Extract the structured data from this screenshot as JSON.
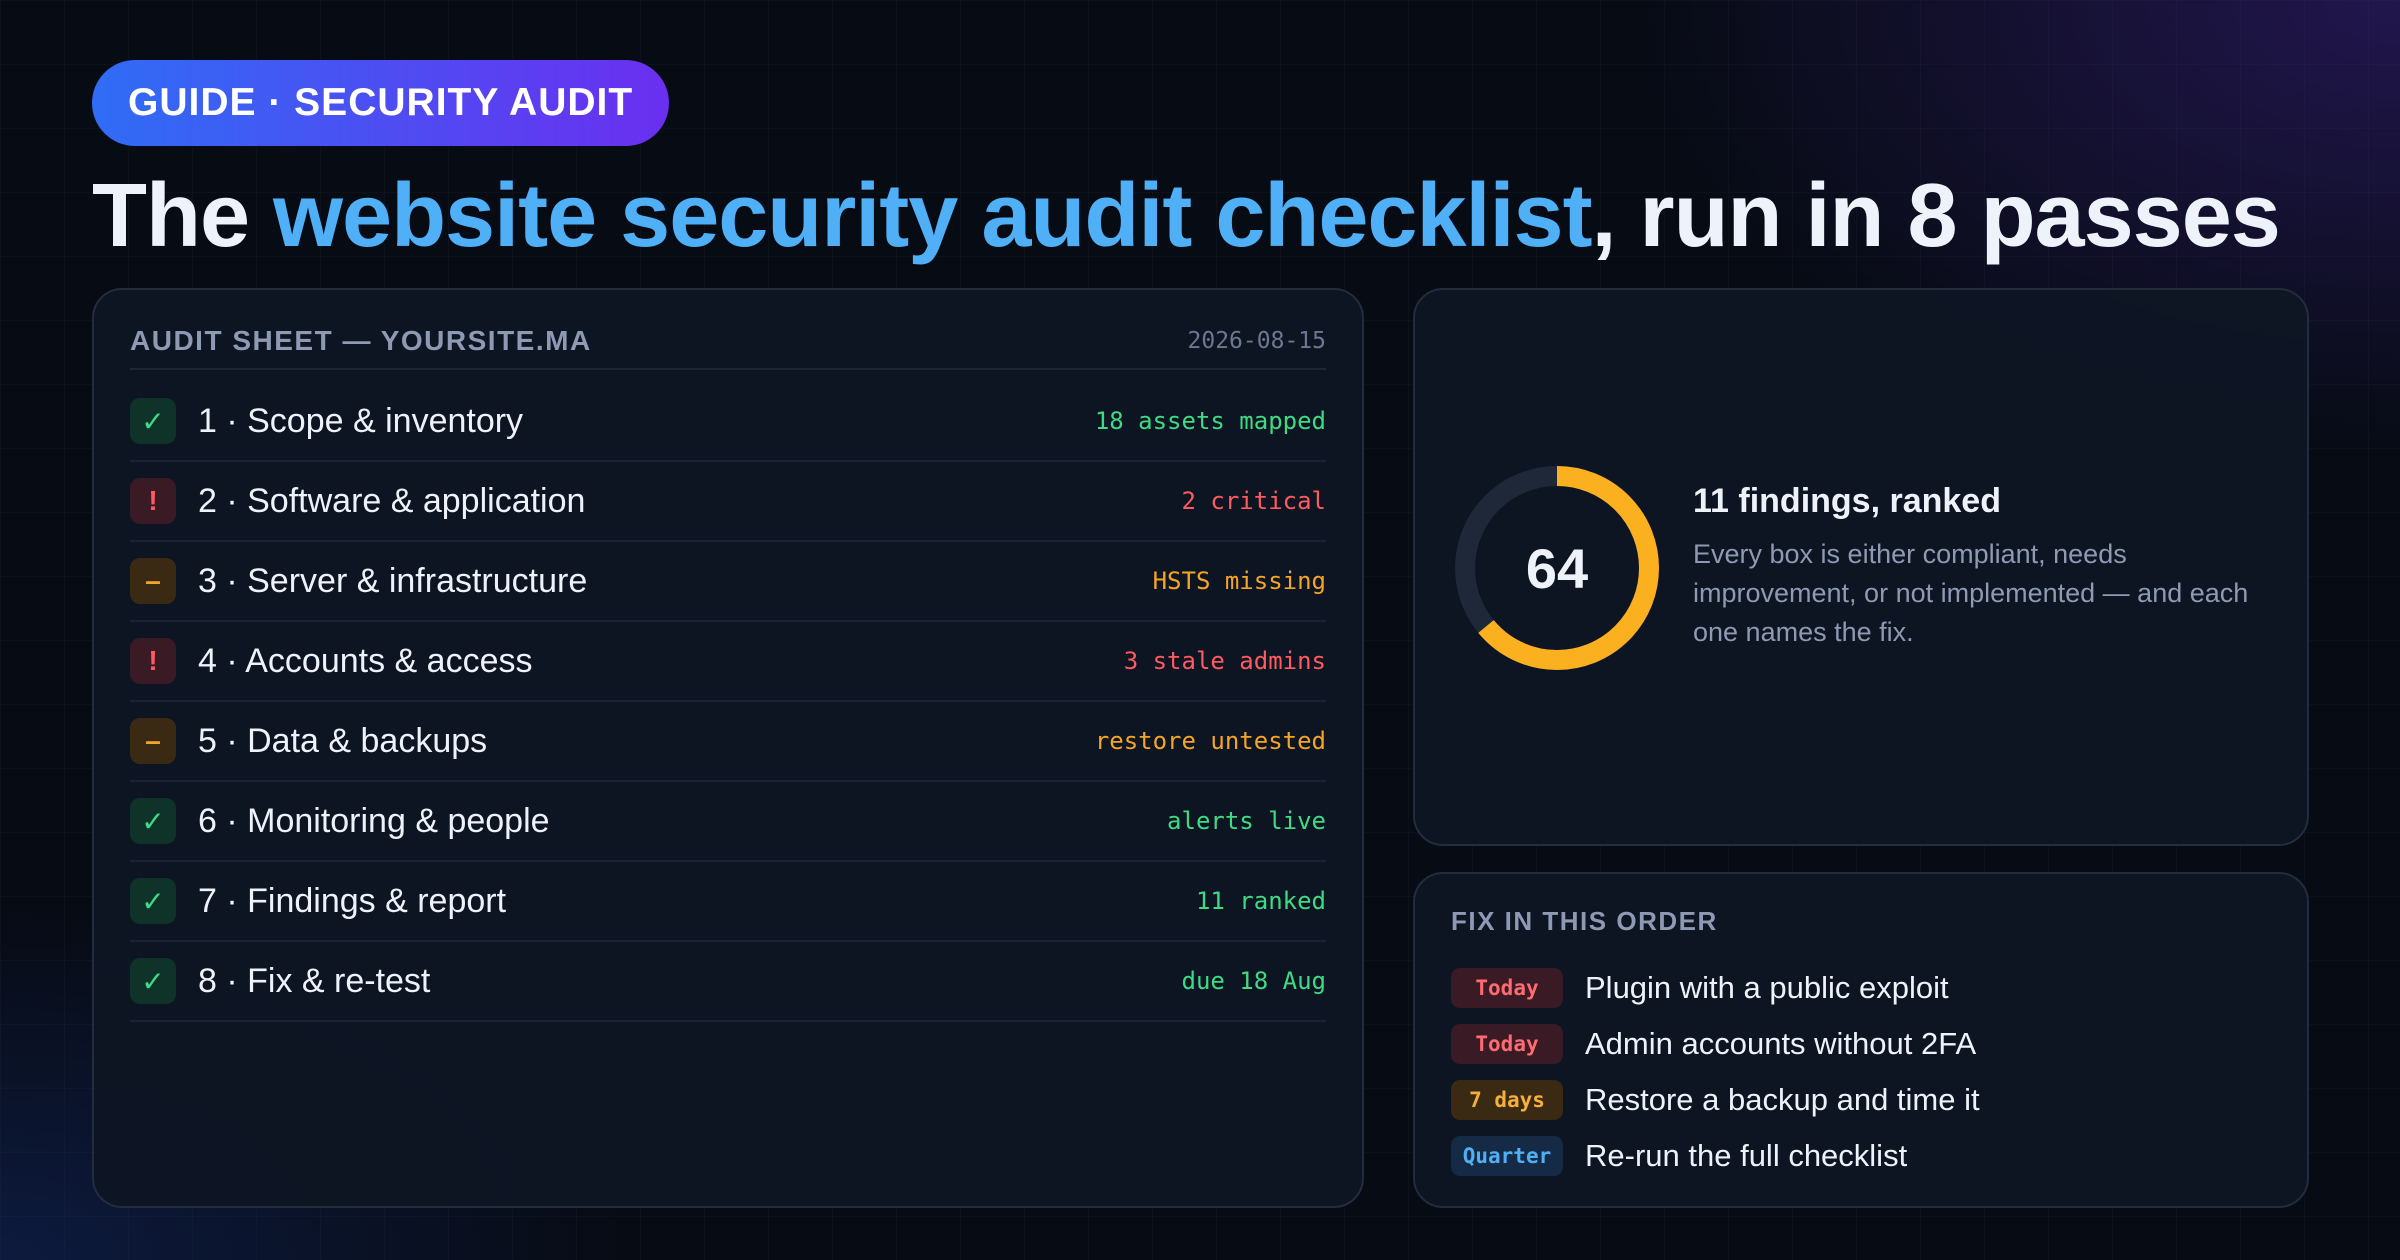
{
  "badge": "GUIDE · SECURITY AUDIT",
  "title": {
    "prefix": "The ",
    "highlight": "website security audit checklist",
    "suffix": ", run in 8 passes"
  },
  "colors": {
    "accent_blue": "#4fb0f7",
    "ok_green": "#3ddc84",
    "critical_red": "#ff5a5f",
    "warning_amber": "#f5a524",
    "background": "#070b14"
  },
  "audit_sheet": {
    "title": "AUDIT SHEET — YOURSITE.MA",
    "date": "2026-08-15",
    "rows": [
      {
        "status": "ok",
        "icon": "check-icon",
        "symbol": "✓",
        "label": "1 · Scope & inventory",
        "note": "18 assets mapped"
      },
      {
        "status": "critical",
        "icon": "alert-icon",
        "symbol": "!",
        "label": "2 · Software & application",
        "note": "2 critical"
      },
      {
        "status": "warning",
        "icon": "dash-icon",
        "symbol": "–",
        "label": "3 · Server & infrastructure",
        "note": "HSTS missing"
      },
      {
        "status": "critical",
        "icon": "alert-icon",
        "symbol": "!",
        "label": "4 · Accounts & access",
        "note": "3 stale admins"
      },
      {
        "status": "warning",
        "icon": "dash-icon",
        "symbol": "–",
        "label": "5 · Data & backups",
        "note": "restore untested"
      },
      {
        "status": "ok",
        "icon": "check-icon",
        "symbol": "✓",
        "label": "6 · Monitoring & people",
        "note": "alerts live"
      },
      {
        "status": "ok",
        "icon": "check-icon",
        "symbol": "✓",
        "label": "7 · Findings & report",
        "note": "11 ranked"
      },
      {
        "status": "ok",
        "icon": "check-icon",
        "symbol": "✓",
        "label": "8 · Fix & re-test",
        "note": "due 18 Aug"
      }
    ]
  },
  "score_card": {
    "score": "64",
    "score_fraction": 0.64,
    "title": "11 findings, ranked",
    "description": "Every box is either compliant, needs improvement, or not implemented — and each one names the fix."
  },
  "fix_order": {
    "title": "FIX IN THIS ORDER",
    "items": [
      {
        "tag": "Today",
        "kind": "today",
        "label": "Plugin with a public exploit"
      },
      {
        "tag": "Today",
        "kind": "today",
        "label": "Admin accounts without 2FA"
      },
      {
        "tag": "7 days",
        "kind": "days",
        "label": "Restore a backup and time it"
      },
      {
        "tag": "Quarter",
        "kind": "quarter",
        "label": "Re-run the full checklist"
      }
    ]
  }
}
